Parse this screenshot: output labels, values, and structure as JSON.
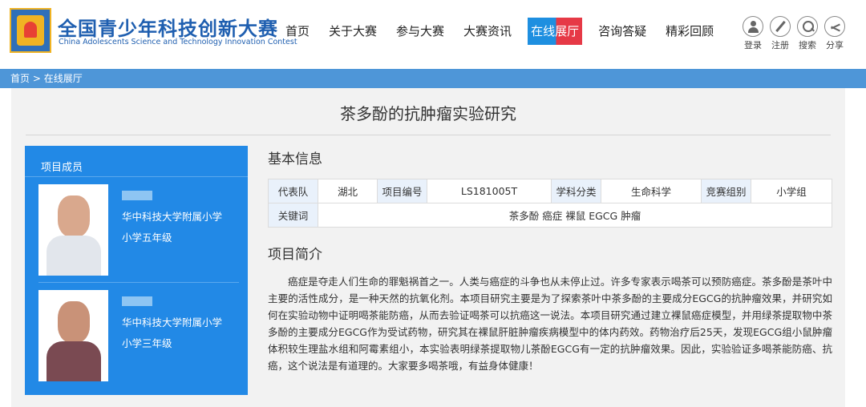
{
  "brand": {
    "title_cn": "全国青少年科技创新大赛",
    "title_en": "China Adolescents Science and Technology Innovation Contest"
  },
  "nav": {
    "items": [
      {
        "label": "首页"
      },
      {
        "label": "关于大赛"
      },
      {
        "label": "参与大赛"
      },
      {
        "label": "大赛资讯"
      },
      {
        "label": "在线展厅",
        "active": true
      },
      {
        "label": "咨询答疑"
      },
      {
        "label": "精彩回顾"
      }
    ]
  },
  "tools": {
    "login": "登录",
    "register": "注册",
    "search": "搜索",
    "share": "分享"
  },
  "breadcrumb": {
    "home": "首页",
    "sep": ">",
    "current": "在线展厅"
  },
  "project": {
    "title": "茶多酚的抗肿瘤实验研究"
  },
  "team": {
    "heading": "项目成员",
    "members": [
      {
        "school": "华中科技大学附属小学",
        "grade": "小学五年级"
      },
      {
        "school": "华中科技大学附属小学",
        "grade": "小学三年级"
      }
    ]
  },
  "basic_info": {
    "heading": "基本信息",
    "labels": {
      "delegation": "代表队",
      "project_no": "项目编号",
      "discipline": "学科分类",
      "group": "竞赛组别",
      "keywords": "关键词"
    },
    "values": {
      "delegation": "湖北",
      "project_no": "LS181005T",
      "discipline": "生命科学",
      "group": "小学组",
      "keywords": "茶多酚 癌症 裸鼠 EGCG 肿瘤"
    }
  },
  "summary": {
    "heading": "项目简介",
    "text": "癌症是夺走人们生命的罪魁祸首之一。人类与癌症的斗争也从未停止过。许多专家表示喝茶可以预防癌症。茶多酚是茶叶中主要的活性成分，是一种天然的抗氧化剂。本项目研究主要是为了探索茶叶中茶多酚的主要成分EGCG的抗肿瘤效果，并研究如何在实验动物中证明喝茶能防癌，从而去验证喝茶可以抗癌这一说法。本项目研究通过建立裸鼠癌症模型，并用绿茶提取物中茶多酚的主要成分EGCG作为受试药物，研究其在裸鼠肝脏肿瘤疾病模型中的体内药效。药物治疗后25天，发现EGCG组小鼠肿瘤体积较生理盐水组和阿霉素组小，本实验表明绿茶提取物儿茶酚EGCG有一定的抗肿瘤效果。因此，实验验证多喝茶能防癌、抗癌，这个说法是有道理的。大家要多喝茶哦，有益身体健康！"
  },
  "colors": {
    "brand_blue": "#1f5fb0",
    "nav_active_blue": "#1e8fe0",
    "nav_active_red": "#e63946",
    "breadcrumb_bg": "#4e96d8",
    "team_panel_bg": "#2289e6"
  }
}
